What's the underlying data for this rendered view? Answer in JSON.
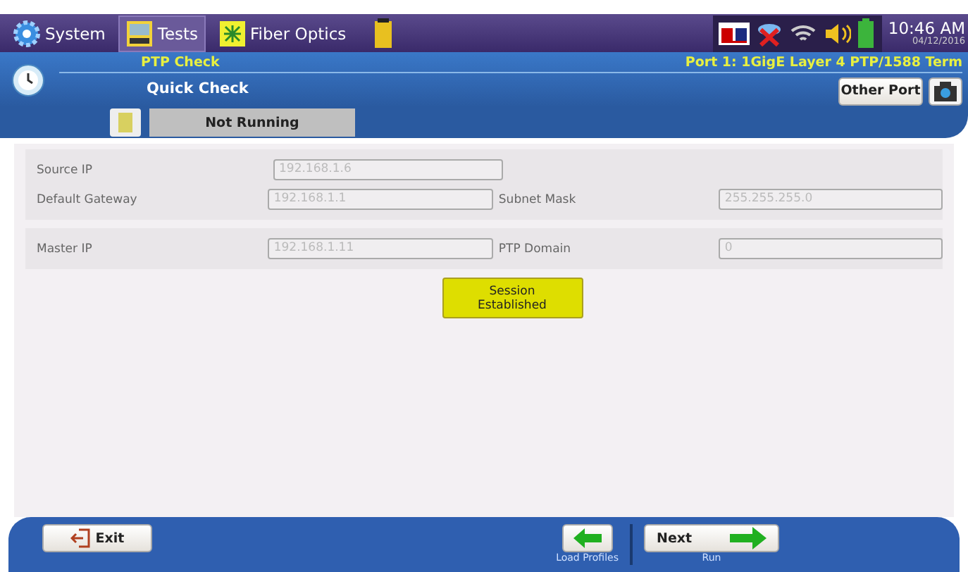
{
  "top_bar": {
    "tabs": [
      {
        "label": "System",
        "selected": false,
        "kind": "gear"
      },
      {
        "label": "Tests",
        "selected": true,
        "kind": "bert"
      },
      {
        "label": "Fiber Optics",
        "selected": false,
        "kind": "fiber"
      }
    ],
    "time": "10:46 AM",
    "date": "04/12/2016"
  },
  "header": {
    "test": "PTP Check",
    "mode": "Quick Check",
    "port": "Port 1: 1GigE Layer 4 PTP/1588 Term",
    "other_port": "Other Port",
    "status": "Not Running"
  },
  "groups": [
    {
      "rows": [
        {
          "label": "Source IP",
          "value": "192.168.1.6"
        },
        {
          "label": "Default Gateway",
          "value": "192.168.1.1",
          "label2": "Subnet Mask",
          "value2": "255.255.255.0"
        }
      ]
    },
    {
      "rows": [
        {
          "label": "Master IP",
          "value": "192.168.1.11",
          "label2": "PTP Domain",
          "value2": "0"
        }
      ]
    }
  ],
  "session_status": "Session\nEstablished",
  "bottom_bar": {
    "exit": "Exit",
    "load_caption": "Load Profiles",
    "next": "Next",
    "run_caption": "Run"
  }
}
